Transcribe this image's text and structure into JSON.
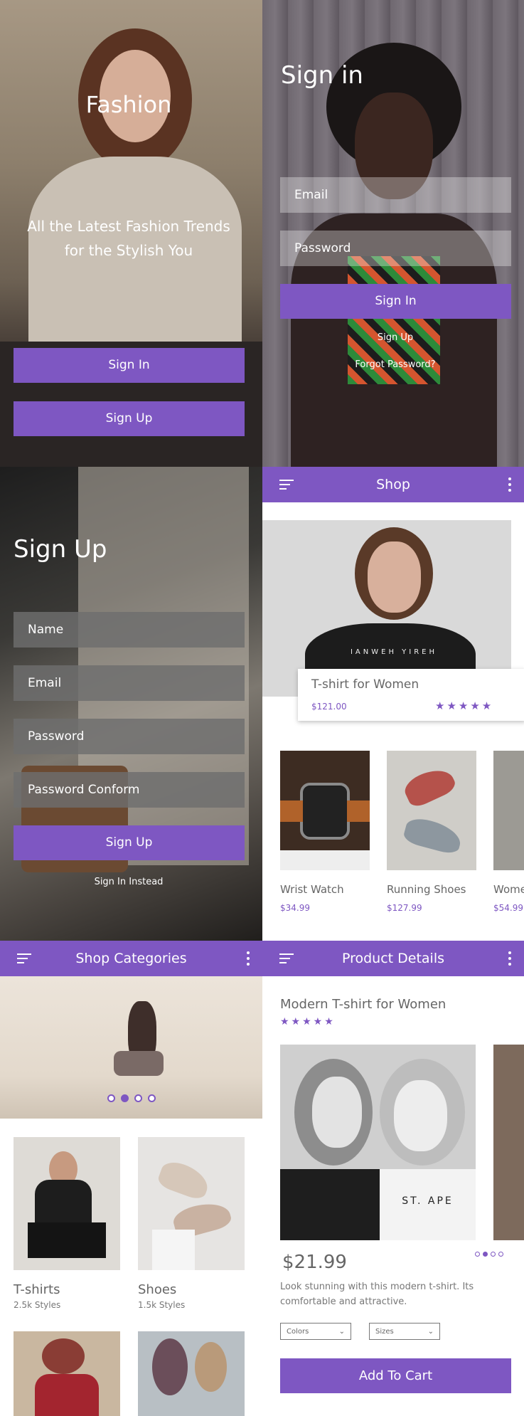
{
  "welcome": {
    "title": "Fashion",
    "tagline_line1": "All the Latest Fashion Trends",
    "tagline_line2": "for the Stylish You",
    "signin_button": "Sign In",
    "signup_button": "Sign Up"
  },
  "signin": {
    "title": "Sign in",
    "email_placeholder": "Email",
    "password_placeholder": "Password",
    "button": "Sign In",
    "signup_link": "Sign Up",
    "forgot_link": "Forgot Password?"
  },
  "signup": {
    "title": "Sign Up",
    "name_placeholder": "Name",
    "email_placeholder": "Email",
    "password_placeholder": "Password",
    "confirm_placeholder": "Password Conform",
    "button": "Sign Up",
    "signin_link": "Sign In Instead"
  },
  "shop": {
    "title": "Shop",
    "featured": {
      "name": "T-shirt for Women",
      "price": "$121.00",
      "stars": "★★★★★"
    },
    "products": [
      {
        "name": "Wrist Watch",
        "price": "$34.99"
      },
      {
        "name": "Running Shoes",
        "price": "$127.99"
      },
      {
        "name": "Wome",
        "price": "$54.99"
      }
    ]
  },
  "categories": {
    "title": "Shop Categories",
    "items": [
      {
        "name": "T-shirts",
        "count": "2.5k Styles"
      },
      {
        "name": "Shoes",
        "count": "1.5k Styles"
      }
    ]
  },
  "details": {
    "title": "Product Details",
    "product_name": "Modern T-shirt for Women",
    "stars": "★★★★★",
    "shirt_print": "ST. APE",
    "price": "$21.99",
    "desc_line1": "Look stunning with this modern t-shirt. Its",
    "desc_line2": "comfortable and attractive.",
    "colors_select": "Colors",
    "sizes_select": "Sizes",
    "cart_button": "Add To Cart"
  },
  "colors": {
    "accent": "#7e57c2"
  }
}
